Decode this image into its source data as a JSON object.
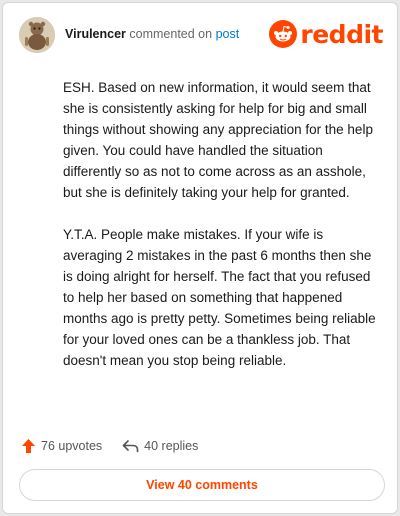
{
  "comment": {
    "username": "Virulencer",
    "action_text": "commented on",
    "post_link": "post",
    "paragraphs": [
      "ESH. Based on new information, it would seem that she is consistently asking for help for big and small things without showing any appreciation for the help given. You could have handled the situation differently so as not to come across as an asshole, but she is definitely taking your help for granted.",
      "Y.T.A. People make mistakes. If your wife is averaging 2 mistakes in the past 6 months then she is doing alright for herself. The fact that you refused to help her based on something that happened months ago is pretty petty. Sometimes being reliable for your loved ones can be a thankless job. That doesn't mean you stop being reliable."
    ]
  },
  "brand": {
    "logo_text": "reddit",
    "color": "#ff4500"
  },
  "footer": {
    "upvotes": "76 upvotes",
    "replies": "40 replies"
  },
  "view_button": {
    "label": "View 40 comments"
  },
  "icons": {
    "avatar": "avatar-icon",
    "logo": "reddit-snoo-icon",
    "upvote": "upvote-arrow-icon",
    "reply": "reply-arrow-icon"
  }
}
